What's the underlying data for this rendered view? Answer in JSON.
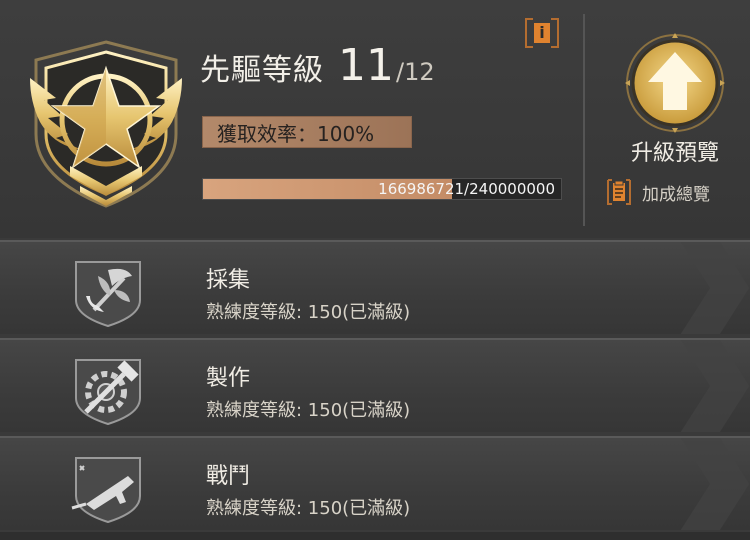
{
  "header": {
    "title": "先驅等級",
    "level": "11",
    "level_max": "/12",
    "info_glyph": "i",
    "efficiency_text": "獲取效率：100%",
    "xp_text": "166986721/240000000",
    "xp_progress": 0.6958,
    "upgrade_label": "升級預覽",
    "bonus_label": "加成總覽"
  },
  "skills": [
    {
      "name": "採集",
      "proficiency": "熟練度等級: 150(已滿級)",
      "icon": "leaf-sickle-icon"
    },
    {
      "name": "製作",
      "proficiency": "熟練度等級: 150(已滿級)",
      "icon": "gear-hammer-icon"
    },
    {
      "name": "戰鬥",
      "proficiency": "熟練度等級: 150(已滿級)",
      "icon": "submachine-gun-icon"
    }
  ],
  "colors": {
    "accent_orange": "#e0832f",
    "gold": "#e8c97a",
    "efficiency_bg": "#b3896a",
    "xp_fill": "#d8a47e"
  }
}
